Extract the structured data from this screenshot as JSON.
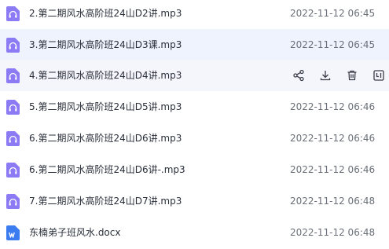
{
  "files": [
    {
      "name": "2.第二期风水高阶班24山D2讲.mp3",
      "date": "2022-11-12 06:45",
      "type": "audio",
      "state": "normal"
    },
    {
      "name": "3.第二期风水高阶班24山D3课.mp3",
      "date": "2022-11-12 06:45",
      "type": "audio",
      "state": "selected"
    },
    {
      "name": "4.第二期风水高阶班24山D4讲.mp3",
      "date": "",
      "type": "audio",
      "state": "hovered"
    },
    {
      "name": "5.第二期风水高阶班24山D5讲.mp3",
      "date": "2022-11-12 06:46",
      "type": "audio",
      "state": "normal"
    },
    {
      "name": "6.第二期风水高阶班24山D6讲.mp3",
      "date": "2022-11-12 06:46",
      "type": "audio",
      "state": "normal"
    },
    {
      "name": "6.第二期风水高阶班24山D6讲-.mp3",
      "date": "2022-11-12 06:46",
      "type": "audio",
      "state": "normal"
    },
    {
      "name": "7.第二期风水高阶班24山D7讲.mp3",
      "date": "2022-11-12 06:48",
      "type": "audio",
      "state": "normal"
    },
    {
      "name": "东楠弟子班风水.docx",
      "date": "2022-11-12 06:48",
      "type": "word",
      "state": "normal"
    }
  ],
  "row_actions": [
    "share-icon",
    "download-icon",
    "delete-icon",
    "more-icon"
  ],
  "colors": {
    "audio_icon": "#8b7cf6",
    "word_icon": "#3b7cf0",
    "selected_bg": "#eef3fd",
    "hover_bg": "#f4f6fb",
    "action_icon": "#3a3f4a"
  }
}
